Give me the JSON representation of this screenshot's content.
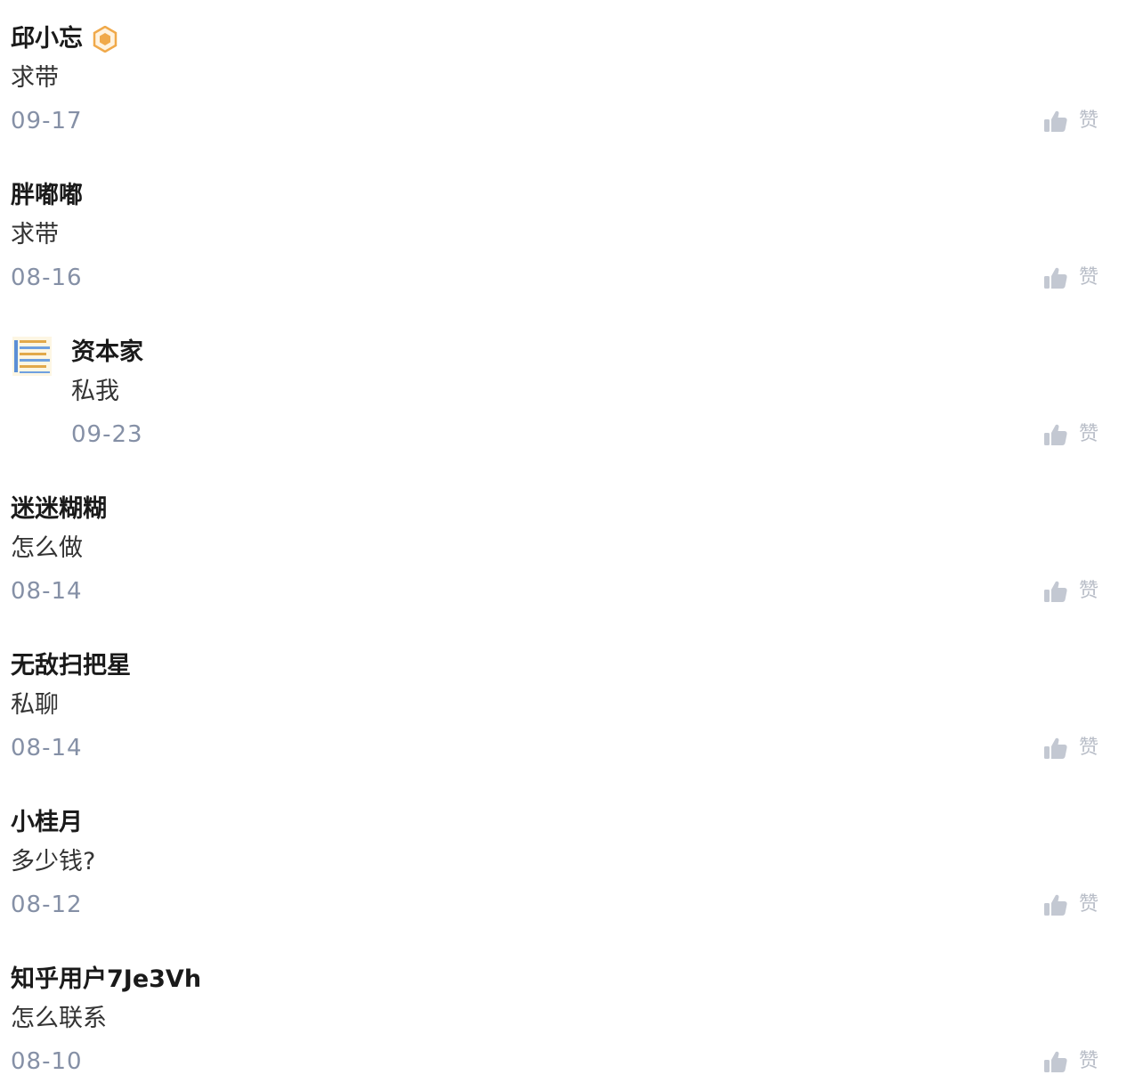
{
  "comments": [
    {
      "author": "邱小忘",
      "badge": "gold-hexagon-badge-icon",
      "text": "求带",
      "date": "09-17",
      "like_label": "赞"
    },
    {
      "author": "胖嘟嘟",
      "text": "求带",
      "date": "08-16",
      "like_label": "赞"
    },
    {
      "author": "资本家",
      "avatar": "striped-avatar",
      "text": "私我",
      "date": "09-23",
      "like_label": "赞"
    },
    {
      "author": "迷迷糊糊",
      "text": "怎么做",
      "date": "08-14",
      "like_label": "赞"
    },
    {
      "author": "无敌扫把星",
      "text": "私聊",
      "date": "08-14",
      "like_label": "赞"
    },
    {
      "author": "小桂月",
      "text": "多少钱?",
      "date": "08-12",
      "like_label": "赞"
    },
    {
      "author": "知乎用户7Je3Vh",
      "text": "怎么联系",
      "date": "08-10",
      "like_label": "赞"
    }
  ],
  "colors": {
    "author": "#1a1a1a",
    "text": "#333333",
    "date": "#8590a6",
    "like": "#c3c8d2",
    "badge": "#f0a94a"
  }
}
